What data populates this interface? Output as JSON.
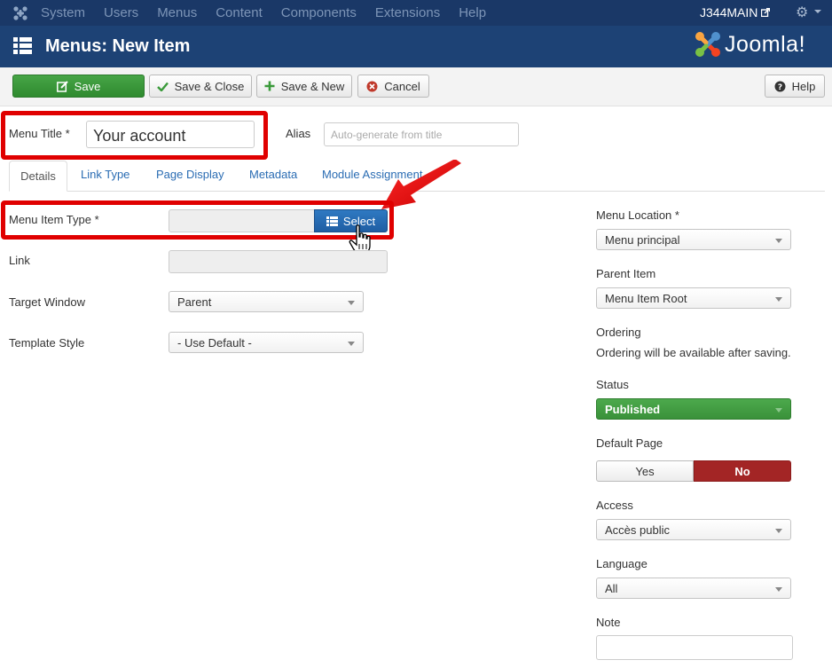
{
  "topnav": {
    "items": [
      "System",
      "Users",
      "Menus",
      "Content",
      "Components",
      "Extensions",
      "Help"
    ],
    "site_name": "J344MAIN"
  },
  "header": {
    "title": "Menus: New Item",
    "brand": "Joomla!"
  },
  "toolbar": {
    "save": "Save",
    "save_close": "Save & Close",
    "save_new": "Save & New",
    "cancel": "Cancel",
    "help": "Help"
  },
  "form": {
    "menu_title_label": "Menu Title *",
    "menu_title_value": "Your account",
    "alias_label": "Alias",
    "alias_placeholder": "Auto-generate from title"
  },
  "tabs": [
    "Details",
    "Link Type",
    "Page Display",
    "Metadata",
    "Module Assignment"
  ],
  "details": {
    "menu_item_type_label": "Menu Item Type *",
    "select_button": "Select",
    "link_label": "Link",
    "target_window_label": "Target Window",
    "target_window_value": "Parent",
    "template_style_label": "Template Style",
    "template_style_value": "- Use Default -"
  },
  "sidebar": {
    "menu_location_label": "Menu Location *",
    "menu_location_value": "Menu principal",
    "parent_item_label": "Parent Item",
    "parent_item_value": "Menu Item Root",
    "ordering_label": "Ordering",
    "ordering_text": "Ordering will be available after saving.",
    "status_label": "Status",
    "status_value": "Published",
    "default_page_label": "Default Page",
    "default_yes": "Yes",
    "default_no": "No",
    "access_label": "Access",
    "access_value": "Accès public",
    "language_label": "Language",
    "language_value": "All",
    "note_label": "Note"
  },
  "colors": {
    "nav_bg": "#1a3867",
    "header_bg": "#1d4275",
    "save_green": "#3a9a3a",
    "select_blue": "#2567ad",
    "no_red": "#a32525",
    "highlight_red": "#e00000"
  }
}
